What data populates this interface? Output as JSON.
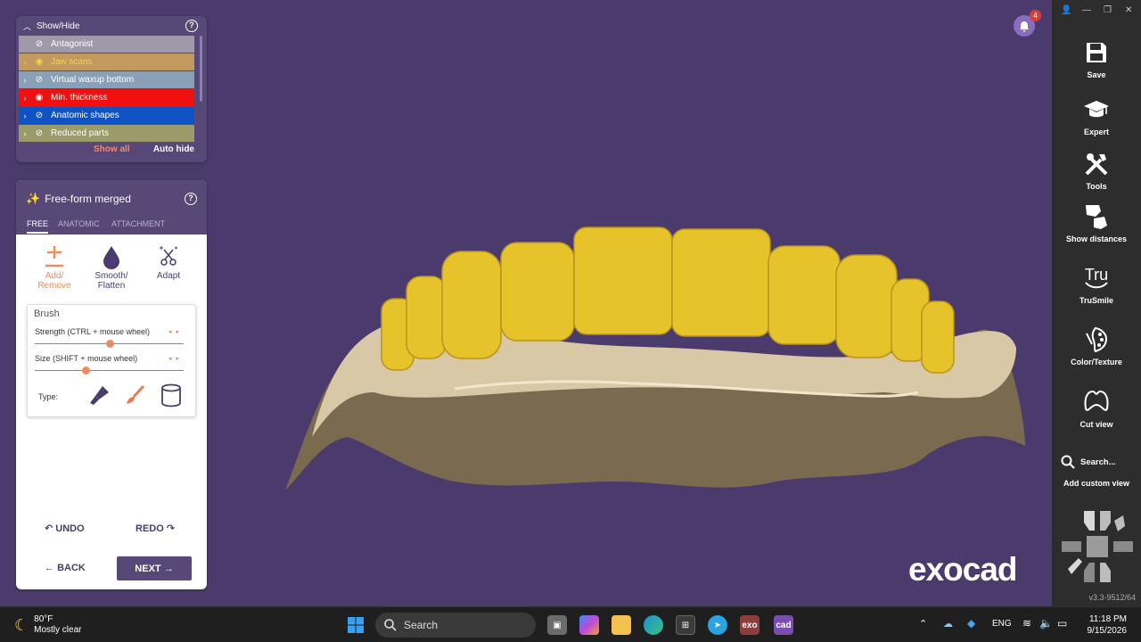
{
  "show_hide": {
    "title": "Show/Hide",
    "layers": [
      {
        "label": "Antagonist",
        "color": "#9f9aa9",
        "text_color": "#ffffff",
        "expandable": false,
        "visible": false
      },
      {
        "label": "Jaw scans",
        "color": "#c29a5f",
        "text_color": "#f5d24b",
        "expandable": true,
        "visible": true
      },
      {
        "label": "Virtual waxup bottom",
        "color": "#8aa0b6",
        "text_color": "#ffffff",
        "expandable": true,
        "visible": false
      },
      {
        "label": "Min. thickness",
        "color": "#f01010",
        "text_color": "#ffffff",
        "expandable": true,
        "visible": true
      },
      {
        "label": "Anatomic shapes",
        "color": "#0f52c4",
        "text_color": "#ffffff",
        "expandable": true,
        "visible": false
      },
      {
        "label": "Reduced parts",
        "color": "#9b9a6b",
        "text_color": "#ffffff",
        "expandable": true,
        "visible": false
      }
    ],
    "show_all": "Show all",
    "auto_hide": "Auto hide"
  },
  "freeform": {
    "title": "Free-form merged",
    "tabs": [
      "FREE",
      "ANATOMIC",
      "ATTACHMENT"
    ],
    "active_tab": "FREE",
    "tools": [
      {
        "label_line1": "Add/",
        "label_line2": "Remove",
        "icon": "plus-minus-icon",
        "active": true
      },
      {
        "label_line1": "Smooth/",
        "label_line2": "Flatten",
        "icon": "drop-icon",
        "active": false
      },
      {
        "label_line1": "Adapt",
        "label_line2": "",
        "icon": "scissors-sparkle-icon",
        "active": false
      }
    ],
    "brush": {
      "label": "Brush",
      "strength_label": "Strength (CTRL + mouse wheel)",
      "strength_value": 0.5,
      "size_label": "Size (SHIFT + mouse wheel)",
      "size_value": 0.34,
      "type_label": "Type:"
    },
    "undo": "UNDO",
    "redo": "REDO",
    "back": "BACK",
    "next": "NEXT"
  },
  "right_toolbar": {
    "tools": [
      {
        "label": "Save",
        "icon": "save-icon"
      },
      {
        "label": "Expert",
        "icon": "graduation-cap-icon"
      },
      {
        "label": "Tools",
        "icon": "tools-icon"
      },
      {
        "label": "Show distances",
        "icon": "distances-icon"
      },
      {
        "label": "TruSmile",
        "icon": "trusmile-icon"
      },
      {
        "label": "Color/Texture",
        "icon": "palette-icon"
      },
      {
        "label": "Cut view",
        "icon": "cut-view-icon"
      }
    ],
    "search": "Search...",
    "custom_view": "Add custom view",
    "version": "v3.3-9512/64",
    "trusmile_text": "Tru"
  },
  "notifications": {
    "count": "4"
  },
  "logo": "exocad",
  "taskbar": {
    "weather_temp": "80°F",
    "weather_desc": "Mostly clear",
    "search_placeholder": "Search",
    "app_exo": "exo",
    "app_cad": "cad",
    "language": "ENG",
    "time": "11:18 PM",
    "date": "9/15/2026"
  }
}
